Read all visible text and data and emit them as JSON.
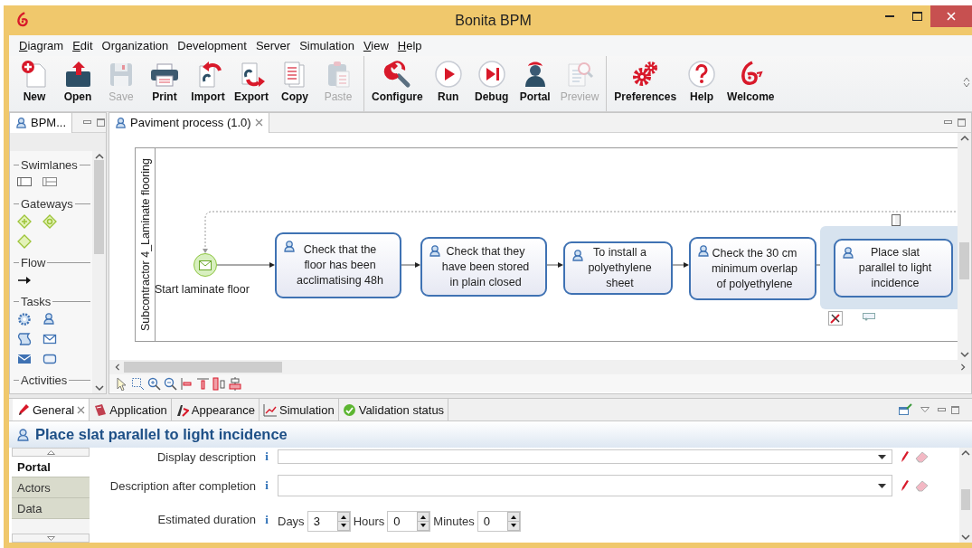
{
  "window": {
    "title": "Bonita BPM"
  },
  "menu": [
    {
      "label": "Diagram",
      "underline_first": true
    },
    {
      "label": "Edit",
      "underline_first": true
    },
    {
      "label": "Organization",
      "underline_first": false
    },
    {
      "label": "Development",
      "underline_first": false
    },
    {
      "label": "Server",
      "underline_first": false
    },
    {
      "label": "Simulation",
      "underline_first": false
    },
    {
      "label": "View",
      "underline_first": true
    },
    {
      "label": "Help",
      "underline_first": true
    }
  ],
  "toolbar_groups": [
    {
      "items": [
        {
          "label": "New",
          "disabled": false
        },
        {
          "label": "Open",
          "disabled": false
        },
        {
          "label": "Save",
          "disabled": true
        },
        {
          "label": "Print",
          "disabled": false
        },
        {
          "label": "Import",
          "disabled": false
        },
        {
          "label": "Export",
          "disabled": false
        },
        {
          "label": "Copy",
          "disabled": false
        },
        {
          "label": "Paste",
          "disabled": true
        }
      ]
    },
    {
      "items": [
        {
          "label": "Configure",
          "disabled": false
        },
        {
          "label": "Run",
          "disabled": false
        },
        {
          "label": "Debug",
          "disabled": false
        },
        {
          "label": "Portal",
          "disabled": false
        },
        {
          "label": "Preview",
          "disabled": true
        }
      ]
    },
    {
      "items": [
        {
          "label": "Preferences",
          "disabled": false
        },
        {
          "label": "Help",
          "disabled": false
        },
        {
          "label": "Welcome",
          "disabled": false
        }
      ]
    }
  ],
  "palette_tab": {
    "label": "BPM..."
  },
  "palette": {
    "sections": [
      {
        "title": "Swimlanes"
      },
      {
        "title": "Gateways"
      },
      {
        "title": "Flow"
      },
      {
        "title": "Tasks"
      },
      {
        "title": "Activities"
      }
    ]
  },
  "editor_tab": {
    "label": "Paviment process (1.0)",
    "closable": true
  },
  "diagram": {
    "lane": "Subcontractor 4_Laminate flooring",
    "start_event": {
      "label": "Start laminate floor"
    },
    "tasks": [
      {
        "label": "Check that the floor has been acclimatising 48h",
        "selected": false
      },
      {
        "label": "Check that they have been stored in plain closed",
        "selected": false
      },
      {
        "label": "To install a polyethylene sheet",
        "selected": false
      },
      {
        "label": "Check the 30 cm minimum overlap of polyethylene",
        "selected": false
      },
      {
        "label": "Place slat parallel to light incidence",
        "selected": true
      }
    ]
  },
  "properties": {
    "tabs": [
      {
        "label": "General",
        "selected": true,
        "closable": true
      },
      {
        "label": "Application",
        "selected": false,
        "closable": false
      },
      {
        "label": "Appearance",
        "selected": false,
        "closable": false
      },
      {
        "label": "Simulation",
        "selected": false,
        "closable": false
      },
      {
        "label": "Validation status",
        "selected": false,
        "closable": false
      }
    ],
    "title": "Place slat parallel to light incidence",
    "sections": [
      {
        "label": "Portal",
        "selected": true
      },
      {
        "label": "Actors",
        "selected": false
      },
      {
        "label": "Data",
        "selected": false
      }
    ],
    "rows": [
      {
        "kind": "combo",
        "label": "Display description",
        "info": "i"
      },
      {
        "kind": "combo",
        "label": "Description after completion",
        "info": "i"
      },
      {
        "kind": "duration",
        "label": "Estimated duration",
        "info": "i",
        "spinners": [
          {
            "unit": "Days",
            "value": "3"
          },
          {
            "unit": "Hours",
            "value": "0"
          },
          {
            "unit": "Minutes",
            "value": "0"
          }
        ]
      }
    ]
  }
}
